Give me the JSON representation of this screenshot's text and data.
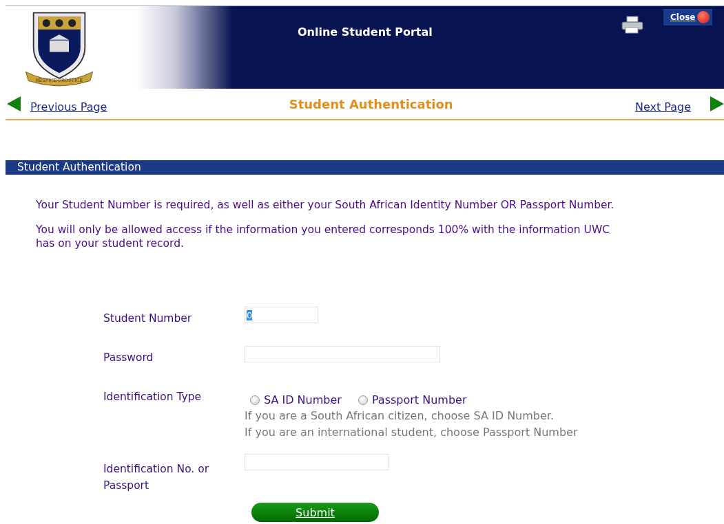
{
  "header": {
    "motto": "RESPICE PROSPICE",
    "title": "Online Student Portal",
    "close": "Close"
  },
  "nav": {
    "previous": "Previous Page",
    "title": "Student Authentication",
    "next": "Next Page"
  },
  "section": {
    "title": "Student Authentication",
    "paragraphs": [
      "Your Student Number is required, as well as either your South African Identity Number OR Passport Number.",
      "You will only be allowed access if the information you entered corresponds 100% with the information UWC has on your student record."
    ]
  },
  "form": {
    "student_number": {
      "label": "Student Number",
      "value": "0",
      "value_selected": true
    },
    "password": {
      "label": "Password"
    },
    "identification_type": {
      "label": "Identification Type",
      "options": [
        {
          "label": "SA ID Number",
          "selected": false
        },
        {
          "label": "Passport Number",
          "selected": false
        }
      ],
      "help": [
        "If you are a South African citizen, choose SA ID Number.",
        "If you are an international student, choose Passport Number"
      ]
    },
    "identification_no": {
      "label": "Identification No. or Passport"
    },
    "submit": "Submit"
  }
}
